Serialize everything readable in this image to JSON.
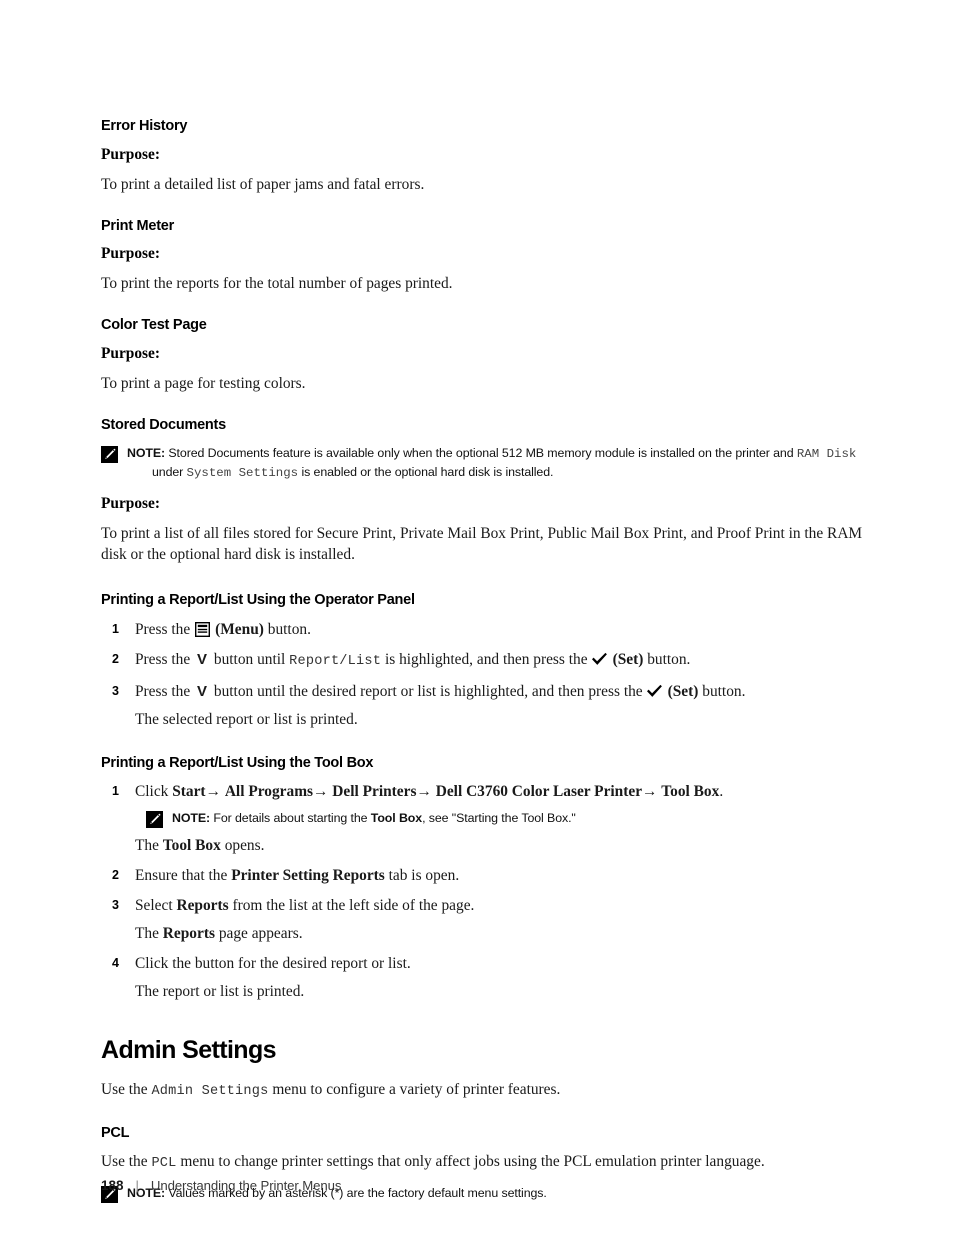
{
  "document": {
    "page_number": "188",
    "footer_separator": "|",
    "footer_title": "Understanding the Printer Menus"
  },
  "icons": {
    "note": "note-pencil-icon",
    "menu": "menu-button-icon",
    "set": "check-set-icon",
    "down": "down-arrow-glyph"
  },
  "sections": {
    "error_history": {
      "heading": "Error History",
      "purpose_label": "Purpose:",
      "purpose_text": "To print a detailed list of paper jams and fatal errors."
    },
    "print_meter": {
      "heading": "Print Meter",
      "purpose_label": "Purpose:",
      "purpose_text": "To print the reports for the total number of pages printed."
    },
    "color_test_page": {
      "heading": "Color Test Page",
      "purpose_label": "Purpose:",
      "purpose_text": "To print a page for testing colors."
    },
    "stored_documents": {
      "heading": "Stored Documents",
      "note": {
        "label": "NOTE:",
        "part1": "Stored Documents feature is available only when the optional 512 MB memory module is installed on the printer and",
        "mono1": "RAM Disk",
        "part2": "under",
        "mono2": "System Settings",
        "part3": "is enabled or the optional hard disk is installed."
      },
      "purpose_label": "Purpose:",
      "purpose_text": "To print a list of all files stored for Secure Print, Private Mail Box Print, Public Mail Box Print, and Proof Print in the RAM disk or the optional hard disk is installed."
    },
    "operator_panel": {
      "heading": "Printing a Report/List Using the Operator Panel",
      "steps": [
        {
          "num": "1",
          "pre": "Press the",
          "bold": "(Menu)",
          "post": "button."
        },
        {
          "num": "2",
          "pre": "Press the",
          "mid": "button until",
          "mono": "Report/List",
          "mid2": "is highlighted, and then press the",
          "bold": "(Set)",
          "post": "button."
        },
        {
          "num": "3",
          "pre": "Press the",
          "mid": "button until the desired report or list is highlighted, and then press the",
          "bold": "(Set)",
          "post": "button.",
          "sub": "The selected report or list is printed."
        }
      ]
    },
    "tool_box": {
      "heading": "Printing a Report/List Using the Tool Box",
      "step1": {
        "num": "1",
        "lead": "Click",
        "crumbs": [
          "Start",
          "All Programs",
          "Dell Printers",
          "Dell C3760 Color Laser Printer",
          "Tool Box"
        ],
        "arrow": "→",
        "period": ".",
        "note": {
          "label": "NOTE:",
          "part1": "For details about starting the",
          "bold1": "Tool Box",
          "part2": ", see \"Starting the Tool Box.\""
        },
        "sub_pre": "The",
        "sub_bold": "Tool Box",
        "sub_post": "opens."
      },
      "step2": {
        "num": "2",
        "pre": "Ensure that the",
        "bold": "Printer Setting Reports",
        "post": "tab is open."
      },
      "step3": {
        "num": "3",
        "pre": "Select",
        "bold": "Reports",
        "post": "from the list at the left side of the page.",
        "sub_pre": "The",
        "sub_bold": "Reports",
        "sub_post": "page appears."
      },
      "step4": {
        "num": "4",
        "text": "Click the button for the desired report or list.",
        "sub": "The report or list is printed."
      }
    },
    "admin_settings": {
      "heading": "Admin Settings",
      "intro_pre": "Use the",
      "intro_mono": "Admin Settings",
      "intro_post": "menu to configure a variety of printer features."
    },
    "pcl": {
      "heading": "PCL",
      "intro_pre": "Use the",
      "intro_mono": "PCL",
      "intro_post": "menu to change printer settings that only affect jobs using the PCL emulation printer language.",
      "note": {
        "label": "NOTE:",
        "text": "Values marked by an asterisk (*) are the factory default menu settings."
      }
    }
  }
}
